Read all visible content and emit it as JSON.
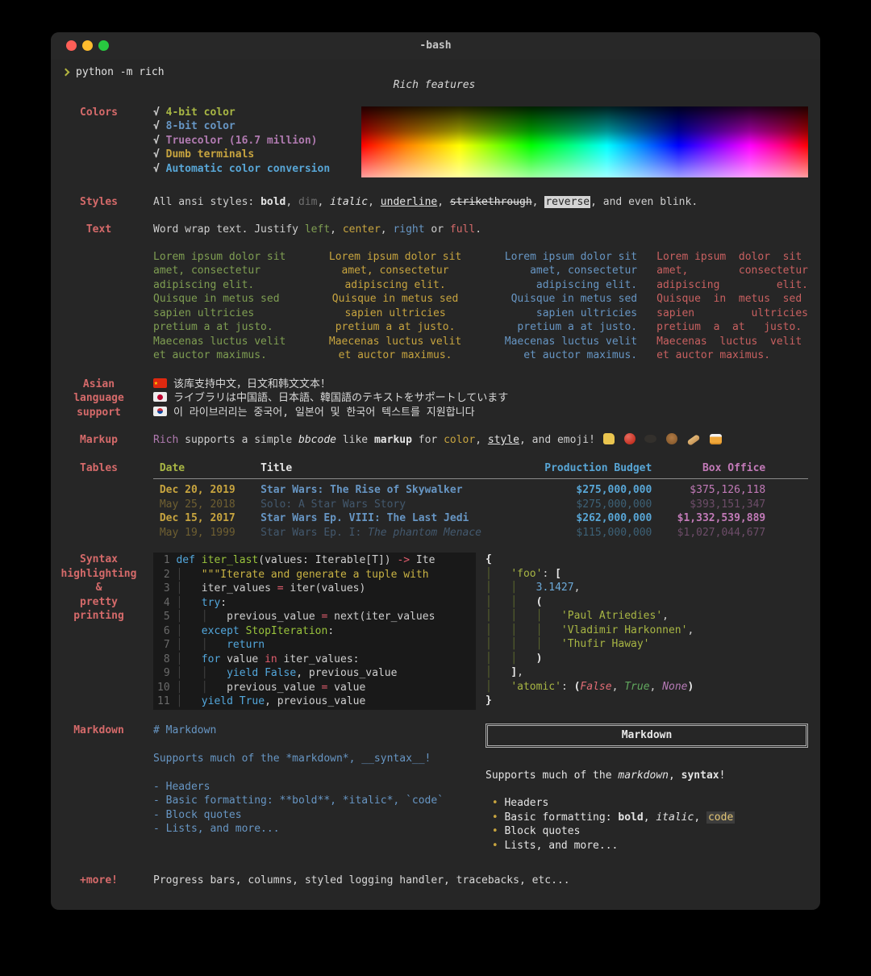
{
  "window": {
    "title": "-bash"
  },
  "prompt": {
    "symbol": "❯",
    "command": "python -m rich"
  },
  "header": {
    "title": "Rich features"
  },
  "colors": {
    "label": "Colors",
    "items": [
      [
        {
          "t": "√ ",
          "c": "chk"
        },
        {
          "t": "4-bit color",
          "c": "ylwgrn b"
        }
      ],
      [
        {
          "t": "√ ",
          "c": "chk"
        },
        {
          "t": "8-bit color",
          "c": "blue b"
        }
      ],
      [
        {
          "t": "√ ",
          "c": "chk"
        },
        {
          "t": "Truecolor (16.7 million)",
          "c": "pur b"
        }
      ],
      [
        {
          "t": "√ ",
          "c": "chk"
        },
        {
          "t": "Dumb terminals",
          "c": "gold b"
        }
      ],
      [
        {
          "t": "√ ",
          "c": "chk"
        },
        {
          "t": "Automatic color conversion",
          "c": "cyan b"
        }
      ]
    ]
  },
  "styles": {
    "label": "Styles",
    "segments": [
      {
        "t": "All ansi styles: ",
        "c": "tx"
      },
      {
        "t": "bold",
        "c": "wh b"
      },
      {
        "t": ", ",
        "c": "tx"
      },
      {
        "t": "dim",
        "c": "dim"
      },
      {
        "t": ", ",
        "c": "tx"
      },
      {
        "t": "italic",
        "c": "wh i"
      },
      {
        "t": ", ",
        "c": "tx"
      },
      {
        "t": "underline",
        "c": "wh u"
      },
      {
        "t": ", ",
        "c": "tx"
      },
      {
        "t": "strikethrough",
        "c": "wh st"
      },
      {
        "t": ", ",
        "c": "tx"
      },
      {
        "t": "reverse",
        "c": "rev"
      },
      {
        "t": ", and even blink.",
        "c": "tx"
      }
    ]
  },
  "text": {
    "label": "Text",
    "intro": [
      {
        "t": "Word wrap text. Justify ",
        "c": "tx"
      },
      {
        "t": "left",
        "c": "grn"
      },
      {
        "t": ", ",
        "c": "tx"
      },
      {
        "t": "center",
        "c": "gold"
      },
      {
        "t": ", ",
        "c": "tx"
      },
      {
        "t": "right",
        "c": "blue"
      },
      {
        "t": " or ",
        "c": "tx"
      },
      {
        "t": "full",
        "c": "red"
      },
      {
        "t": ".",
        "c": "tx"
      }
    ],
    "columns": [
      {
        "align": "left",
        "lines": [
          "Lorem ipsum dolor sit",
          "amet, consectetur",
          "adipiscing elit.",
          "Quisque in metus sed",
          "sapien ultricies",
          "pretium a at justo.",
          "Maecenas luctus velit",
          "et auctor maximus."
        ]
      },
      {
        "align": "center",
        "lines": [
          "Lorem ipsum dolor sit",
          "amet, consectetur",
          "adipiscing elit.",
          "Quisque in metus sed",
          "sapien ultricies",
          "pretium a at justo.",
          "Maecenas luctus velit",
          "et auctor maximus."
        ]
      },
      {
        "align": "right",
        "lines": [
          "Lorem ipsum dolor sit",
          "amet, consectetur",
          "adipiscing elit.",
          "Quisque in metus sed",
          "sapien ultricies",
          "pretium a at justo.",
          "Maecenas luctus velit",
          "et auctor maximus."
        ]
      },
      {
        "align": "full",
        "lines": [
          "Lorem ipsum  dolor  sit",
          "amet,        consectetur",
          "adipiscing         elit.",
          "Quisque  in  metus  sed",
          "sapien         ultricies",
          "pretium  a  at   justo.",
          "Maecenas  luctus  velit",
          "et auctor maximus."
        ]
      }
    ]
  },
  "asian": {
    "label": "Asian\nlanguage\nsupport",
    "flags": [
      "china-flag",
      "japan-flag",
      "south-korea-flag"
    ],
    "lines": [
      "该库支持中文，日文和韩文文本！",
      "ライブラリは中国語、日本語、韓国語のテキストをサポートしています",
      "이 라이브러리는 중국어, 일본어 및 한국어 텍스트를 지원합니다"
    ]
  },
  "markup": {
    "label": "Markup",
    "emoji_icons": [
      "thumbs-up",
      "red-apple",
      "ant",
      "bear",
      "baguette-bread",
      "bus"
    ],
    "segments": [
      {
        "t": "Rich",
        "c": "pur"
      },
      {
        "t": " supports a simple ",
        "c": "tx"
      },
      {
        "t": "bbcode",
        "c": "wh i"
      },
      {
        "t": " like ",
        "c": "tx"
      },
      {
        "t": "markup",
        "c": "wh b"
      },
      {
        "t": " for ",
        "c": "tx"
      },
      {
        "t": "color",
        "c": "gold"
      },
      {
        "t": ", ",
        "c": "tx"
      },
      {
        "t": "style",
        "c": "wh u"
      },
      {
        "t": ", and emoji! ",
        "c": "tx"
      },
      {
        "t": "",
        "c": "em em-thumb"
      },
      {
        "t": " ",
        "c": "tx"
      },
      {
        "t": "",
        "c": "em em-apple"
      },
      {
        "t": " ",
        "c": "tx"
      },
      {
        "t": "",
        "c": "em em-ant"
      },
      {
        "t": " ",
        "c": "tx"
      },
      {
        "t": "",
        "c": "em em-bear"
      },
      {
        "t": " ",
        "c": "tx"
      },
      {
        "t": "",
        "c": "em em-bread"
      },
      {
        "t": " ",
        "c": "tx"
      },
      {
        "t": "",
        "c": "em em-bus"
      }
    ]
  },
  "tables": {
    "label": "Tables",
    "header": [
      {
        "t": " Date            ",
        "c": "ylwgrn b"
      },
      {
        "t": "Title                                     ",
        "c": "wh b"
      },
      {
        "t": "   Production Budget",
        "c": "cyan b"
      },
      {
        "t": "        Box Office",
        "c": "mag b"
      }
    ],
    "rows": [
      {
        "s": [
          {
            "t": " Dec 20, 2019    ",
            "c": "gold b"
          },
          {
            "t": "Star Wars: The Rise of Skywalker          ",
            "c": "blue b"
          },
          {
            "t": "        $275,000,000",
            "c": "cyan b"
          },
          {
            "t": "      $375,126,118",
            "c": "mag"
          }
        ]
      },
      {
        "c": "dim",
        "s": [
          {
            "t": " May 25, 2018    ",
            "c": "gold"
          },
          {
            "t": "Solo: A Star Wars Story                   ",
            "c": "blue"
          },
          {
            "t": "        $275,000,000",
            "c": "cyan"
          },
          {
            "t": "      $393,151,347",
            "c": "mag"
          }
        ]
      },
      {
        "s": [
          {
            "t": " Dec 15, 2017    ",
            "c": "gold b"
          },
          {
            "t": "Star Wars Ep. VIII: The Last Jedi         ",
            "c": "blue b"
          },
          {
            "t": "        $262,000,000",
            "c": "cyan b"
          },
          {
            "t": "    $1,332,539,889",
            "c": "mag b"
          }
        ]
      },
      {
        "c": "dim",
        "s": [
          {
            "t": " May 19, 1999    ",
            "c": "gold"
          },
          {
            "t": "Star Wars Ep. I: ",
            "c": "blue"
          },
          {
            "t": "The phantom Menace",
            "c": "blue i"
          },
          {
            "t": "       ",
            "c": "tx"
          },
          {
            "t": "        $115,000,000",
            "c": "cyan"
          },
          {
            "t": "    $1,027,044,677",
            "c": "mag"
          }
        ]
      }
    ]
  },
  "code": {
    "label": "Syntax\nhighlighting\n&\npretty\nprinting",
    "lines": [
      [
        {
          "t": " 1 ",
          "c": "num"
        },
        {
          "t": "def ",
          "c": "kw"
        },
        {
          "t": "iter_last",
          "c": "fn"
        },
        {
          "t": "(values: Iterable[T]) ",
          "c": "tx"
        },
        {
          "t": "->",
          "c": "op"
        },
        {
          "t": " Ite",
          "c": "tx"
        }
      ],
      [
        {
          "t": " 2 ",
          "c": "num"
        },
        {
          "t": "│   ",
          "c": "gd"
        },
        {
          "t": "\"\"\"Iterate and generate a tuple with",
          "c": "doc"
        }
      ],
      [
        {
          "t": " 3 ",
          "c": "num"
        },
        {
          "t": "│   ",
          "c": "gd"
        },
        {
          "t": "iter_values ",
          "c": "tx"
        },
        {
          "t": "=",
          "c": "op"
        },
        {
          "t": " iter(values)",
          "c": "tx"
        }
      ],
      [
        {
          "t": " 4 ",
          "c": "num"
        },
        {
          "t": "│   ",
          "c": "gd"
        },
        {
          "t": "try",
          "c": "kw"
        },
        {
          "t": ":",
          "c": "tx"
        }
      ],
      [
        {
          "t": " 5 ",
          "c": "num"
        },
        {
          "t": "│   │   ",
          "c": "gd"
        },
        {
          "t": "previous_value ",
          "c": "tx"
        },
        {
          "t": "=",
          "c": "op"
        },
        {
          "t": " next(iter_values",
          "c": "tx"
        }
      ],
      [
        {
          "t": " 6 ",
          "c": "num"
        },
        {
          "t": "│   ",
          "c": "gd"
        },
        {
          "t": "except ",
          "c": "kw"
        },
        {
          "t": "StopIteration",
          "c": "cls"
        },
        {
          "t": ":",
          "c": "tx"
        }
      ],
      [
        {
          "t": " 7 ",
          "c": "num"
        },
        {
          "t": "│   │   ",
          "c": "gd"
        },
        {
          "t": "return",
          "c": "kw"
        }
      ],
      [
        {
          "t": " 8 ",
          "c": "num"
        },
        {
          "t": "│   ",
          "c": "gd"
        },
        {
          "t": "for ",
          "c": "kw"
        },
        {
          "t": "value ",
          "c": "tx"
        },
        {
          "t": "in",
          "c": "op"
        },
        {
          "t": " iter_values:",
          "c": "tx"
        }
      ],
      [
        {
          "t": " 9 ",
          "c": "num"
        },
        {
          "t": "│   │   ",
          "c": "gd"
        },
        {
          "t": "yield ",
          "c": "kw"
        },
        {
          "t": "False",
          "c": "kw"
        },
        {
          "t": ", previous_value",
          "c": "tx"
        }
      ],
      [
        {
          "t": "10 ",
          "c": "num"
        },
        {
          "t": "│   │   ",
          "c": "gd"
        },
        {
          "t": "previous_value ",
          "c": "tx"
        },
        {
          "t": "=",
          "c": "op"
        },
        {
          "t": " value",
          "c": "tx"
        }
      ],
      [
        {
          "t": "11 ",
          "c": "num"
        },
        {
          "t": "│   ",
          "c": "gd"
        },
        {
          "t": "yield ",
          "c": "kw"
        },
        {
          "t": "True",
          "c": "kw"
        },
        {
          "t": ", previous_value",
          "c": "tx"
        }
      ]
    ],
    "pretty": [
      [
        {
          "t": "{",
          "c": "pu"
        }
      ],
      [
        {
          "t": "│   ",
          "c": "pgd"
        },
        {
          "t": "'foo'",
          "c": "str"
        },
        {
          "t": ": ",
          "c": "tx"
        },
        {
          "t": "[",
          "c": "pu"
        }
      ],
      [
        {
          "t": "│   │   ",
          "c": "pgd"
        },
        {
          "t": "3.1427",
          "c": "pnum"
        },
        {
          "t": ",",
          "c": "tx"
        }
      ],
      [
        {
          "t": "│   │   ",
          "c": "pgd"
        },
        {
          "t": "(",
          "c": "pu"
        }
      ],
      [
        {
          "t": "│   │   │   ",
          "c": "pgd"
        },
        {
          "t": "'Paul Atriedies'",
          "c": "str"
        },
        {
          "t": ",",
          "c": "tx"
        }
      ],
      [
        {
          "t": "│   │   │   ",
          "c": "pgd"
        },
        {
          "t": "'Vladimir Harkonnen'",
          "c": "str"
        },
        {
          "t": ",",
          "c": "tx"
        }
      ],
      [
        {
          "t": "│   │   │   ",
          "c": "pgd"
        },
        {
          "t": "'Thufir Haway'",
          "c": "str"
        }
      ],
      [
        {
          "t": "│   │   ",
          "c": "pgd"
        },
        {
          "t": ")",
          "c": "pu"
        }
      ],
      [
        {
          "t": "│   ",
          "c": "pgd"
        },
        {
          "t": "]",
          "c": "pu"
        },
        {
          "t": ",",
          "c": "tx"
        }
      ],
      [
        {
          "t": "│   ",
          "c": "pgd"
        },
        {
          "t": "'atomic'",
          "c": "str"
        },
        {
          "t": ": ",
          "c": "tx"
        },
        {
          "t": "(",
          "c": "pu"
        },
        {
          "t": "False",
          "c": "fal"
        },
        {
          "t": ", ",
          "c": "tx"
        },
        {
          "t": "True",
          "c": "tru"
        },
        {
          "t": ", ",
          "c": "tx"
        },
        {
          "t": "None",
          "c": "non"
        },
        {
          "t": ")",
          "c": "pu"
        }
      ],
      [
        {
          "t": "}",
          "c": "pu"
        }
      ]
    ]
  },
  "markdown": {
    "label": "Markdown",
    "raw": [
      "# Markdown",
      "",
      "Supports much of the *markdown*, __syntax__!",
      "",
      "- Headers",
      "- Basic formatting: **bold**, *italic*, `code`",
      "- Block quotes",
      "- Lists, and more..."
    ],
    "box_title": "Markdown",
    "para": [
      {
        "t": "Supports much of the ",
        "c": "wh"
      },
      {
        "t": "markdown",
        "c": "wh i"
      },
      {
        "t": ", ",
        "c": "wh"
      },
      {
        "t": "syntax",
        "c": "wh b"
      },
      {
        "t": "!",
        "c": "wh"
      }
    ],
    "bullets": [
      [
        {
          "t": " • ",
          "c": "gold"
        },
        {
          "t": "Headers",
          "c": "wh"
        }
      ],
      [
        {
          "t": " • ",
          "c": "gold"
        },
        {
          "t": "Basic formatting: ",
          "c": "wh"
        },
        {
          "t": "bold",
          "c": "wh b"
        },
        {
          "t": ", ",
          "c": "wh"
        },
        {
          "t": "italic",
          "c": "wh i"
        },
        {
          "t": ", ",
          "c": "wh"
        },
        {
          "t": "code",
          "c": "chip"
        }
      ],
      [
        {
          "t": " • ",
          "c": "gold"
        },
        {
          "t": "Block quotes",
          "c": "wh"
        }
      ],
      [
        {
          "t": " • ",
          "c": "gold"
        },
        {
          "t": "Lists, and more...",
          "c": "wh"
        }
      ]
    ]
  },
  "more": {
    "label": "+more!",
    "text": "Progress bars, columns, styled logging handler, tracebacks, etc..."
  }
}
